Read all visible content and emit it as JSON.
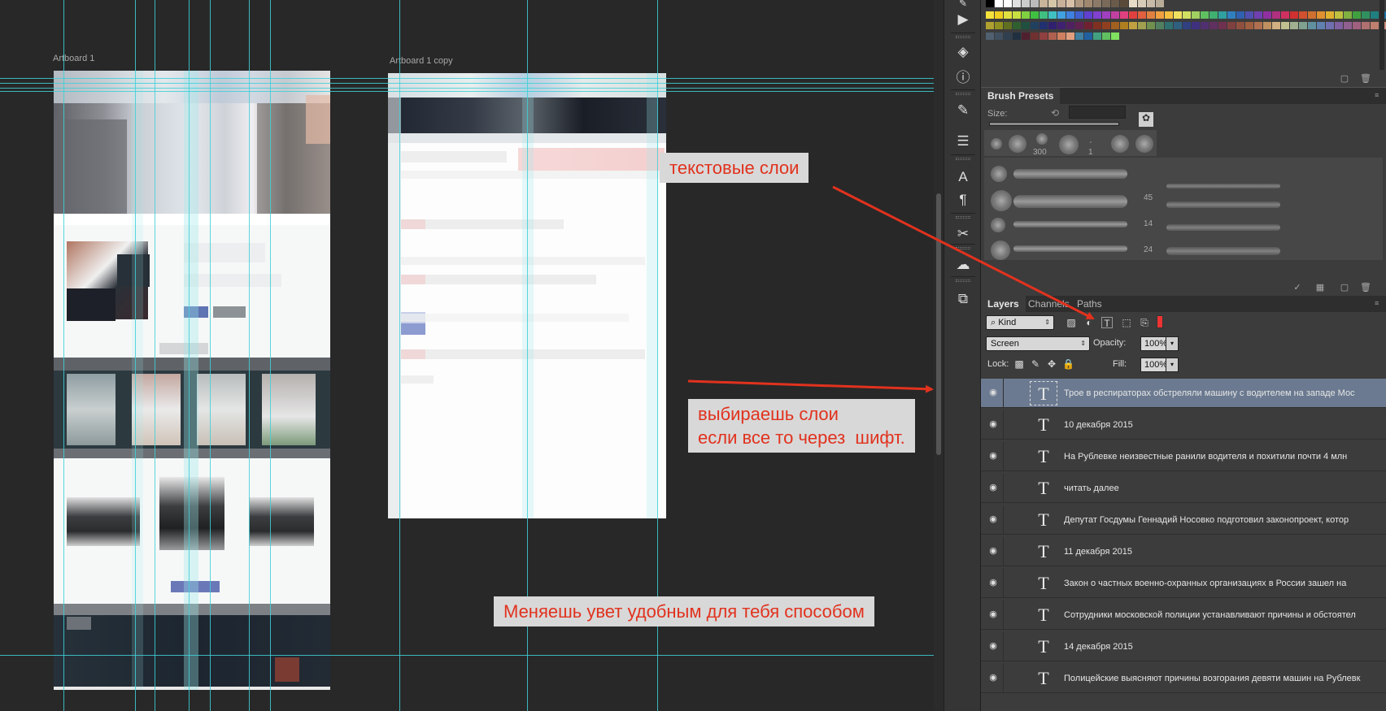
{
  "canvas": {
    "artboard1_label": "Artboard 1",
    "artboard2_label": "Artboard 1 copy"
  },
  "annotations": {
    "text_layers": "текстовые слои",
    "select_layers": "выбираешь слои\nесли все то через  шифт.",
    "change_color": "Меняешь увет удобным для тебя способом"
  },
  "tools": [
    {
      "name": "play-icon",
      "glyph": "▶"
    },
    {
      "name": "3d-icon",
      "glyph": "◈"
    },
    {
      "name": "info-icon",
      "glyph": "ⓘ"
    },
    {
      "name": "brush-tool-icon",
      "glyph": "✎"
    },
    {
      "name": "sliders-icon",
      "glyph": "☰"
    },
    {
      "name": "character-icon",
      "glyph": "A"
    },
    {
      "name": "paragraph-icon",
      "glyph": "¶"
    },
    {
      "name": "tool-presets-icon",
      "glyph": "✂"
    },
    {
      "name": "creative-cloud-icon",
      "glyph": "☁"
    },
    {
      "name": "clone-source-icon",
      "glyph": "⧉"
    }
  ],
  "brush_presets": {
    "tab": "Brush Presets",
    "size_label": "Size:",
    "tip_sizes": [
      "300",
      "1"
    ],
    "stroke_labels": [
      "45",
      "14",
      "24"
    ]
  },
  "layers_panel": {
    "tabs": [
      "Layers",
      "Channels",
      "Paths"
    ],
    "filter_kind": "Kind",
    "blend_mode": "Screen",
    "opacity_label": "Opacity:",
    "opacity_value": "100%",
    "lock_label": "Lock:",
    "fill_label": "Fill:",
    "fill_value": "100%",
    "layers": [
      {
        "name": "Трое в респираторах обстреляли машину с водителем на западе Мос",
        "selected": true
      },
      {
        "name": "10 декабря 2015",
        "selected": false
      },
      {
        "name": "На Рублевке неизвестные ранили водителя и похитили почти 4 млн",
        "selected": false
      },
      {
        "name": "читать далее",
        "selected": false
      },
      {
        "name": "Депутат Госдумы Геннадий Носовко подготовил законопроект, котор",
        "selected": false
      },
      {
        "name": "11 декабря 2015",
        "selected": false
      },
      {
        "name": "Закон о частных военно-охранных организациях в России зашел на",
        "selected": false
      },
      {
        "name": "Сотрудники московской полиции устанавливают причины и обстоятел",
        "selected": false
      },
      {
        "name": "14 декабря 2015",
        "selected": false
      },
      {
        "name": "Полицейские выясняют причины возгорания девяти машин на Рублевк",
        "selected": false
      }
    ]
  },
  "colors": {
    "guide": "#3fd0d6",
    "annotation_text": "#e1321e",
    "annotation_arrow": "#e1321e",
    "selected_layer": "#6b7a90"
  }
}
